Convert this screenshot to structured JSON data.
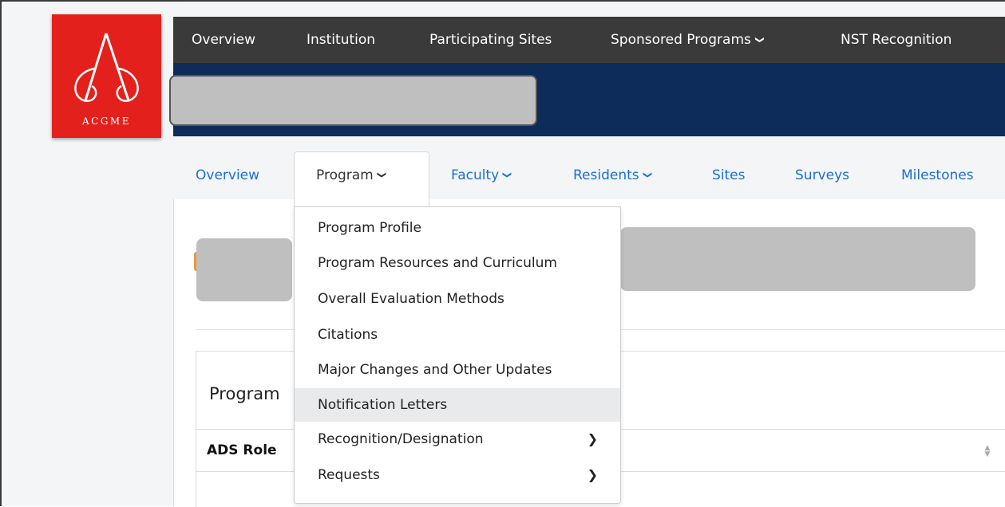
{
  "logo": {
    "text": "ACGME",
    "color": "#e3201b"
  },
  "top_nav": {
    "items": [
      {
        "label": "Overview"
      },
      {
        "label": "Institution"
      },
      {
        "label": "Participating Sites"
      },
      {
        "label": "Sponsored Programs",
        "icon": "chevron-down-icon"
      },
      {
        "label": "NST Recognition"
      }
    ],
    "bg_color": "#3a3a3a",
    "band_color": "#0d2c5a"
  },
  "sub_nav": {
    "items": [
      {
        "label": "Overview"
      },
      {
        "label": "Program",
        "icon": "chevron-down-icon",
        "active": true
      },
      {
        "label": "Faculty",
        "icon": "chevron-down-icon"
      },
      {
        "label": "Residents",
        "icon": "chevron-down-icon"
      },
      {
        "label": "Sites"
      },
      {
        "label": "Surveys"
      },
      {
        "label": "Milestones"
      }
    ],
    "link_color": "#1a6fd4"
  },
  "program_menu": {
    "items": [
      {
        "label": "Program Profile"
      },
      {
        "label": "Program Resources and Curriculum"
      },
      {
        "label": "Overall Evaluation Methods"
      },
      {
        "label": "Citations"
      },
      {
        "label": "Major Changes and Other Updates"
      },
      {
        "label": "Notification Letters",
        "highlighted": true
      },
      {
        "label": "Recognition/Designation",
        "icon": "chevron-right-icon"
      },
      {
        "label": "Requests",
        "icon": "chevron-right-icon"
      }
    ]
  },
  "panel": {
    "title": "Program",
    "table_header": "ADS Role"
  },
  "glyphs": {
    "chevron_down": "❯",
    "chevron_right": "❯",
    "sort": "▲▼"
  }
}
